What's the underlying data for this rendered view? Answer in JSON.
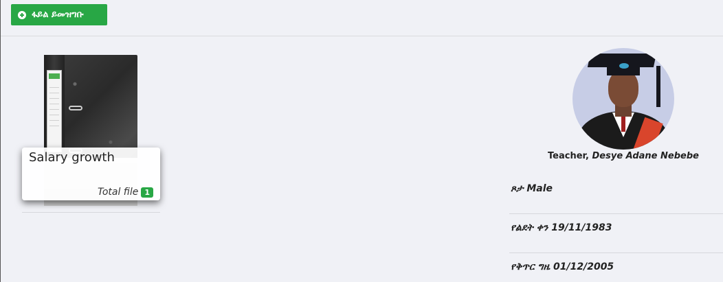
{
  "toolbar": {
    "add_file_label": "ፋይል ይመዝግቡ"
  },
  "file_card": {
    "title": "Salary growth",
    "total_label": "Total file",
    "count": "1"
  },
  "profile": {
    "role": "Teacher,",
    "name": "Desye Adane Nebebe",
    "gender_label": "ጾታ",
    "gender_value": "Male",
    "dob_label": "የልደት ቀን",
    "dob_value": "19/11/1983",
    "hire_label": "የቅጥር ግዜ",
    "hire_value": "01/12/2005"
  },
  "colors": {
    "accent_green": "#28a745",
    "background": "#f0f1f6"
  }
}
